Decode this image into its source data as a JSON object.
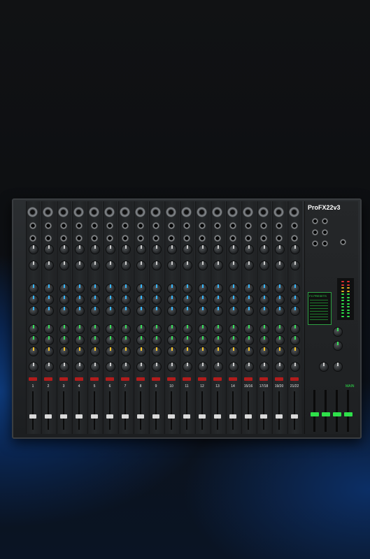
{
  "brand": {
    "logo_text": "ProFX22v3"
  },
  "colors": {
    "accent_green": "#2ee04a",
    "mute_red": "#b01c1c",
    "knob_blue": "#38b6ff",
    "knob_yellow": "#f3c12b"
  },
  "channels": [
    {
      "label": "1"
    },
    {
      "label": "2"
    },
    {
      "label": "3"
    },
    {
      "label": "4"
    },
    {
      "label": "5"
    },
    {
      "label": "6"
    },
    {
      "label": "7"
    },
    {
      "label": "8"
    },
    {
      "label": "9"
    },
    {
      "label": "10"
    },
    {
      "label": "11"
    },
    {
      "label": "12"
    },
    {
      "label": "13"
    },
    {
      "label": "14"
    },
    {
      "label": "15/16"
    },
    {
      "label": "17/18"
    },
    {
      "label": "19/20"
    },
    {
      "label": "21/22"
    }
  ],
  "master": {
    "fx_presets_label": "FX PRESETS",
    "main_label": "MAIN"
  },
  "icons": {
    "xlr_input": "xlr-input-icon",
    "line_input": "line-input-icon",
    "knob": "knob-icon",
    "fader": "fader-icon"
  }
}
